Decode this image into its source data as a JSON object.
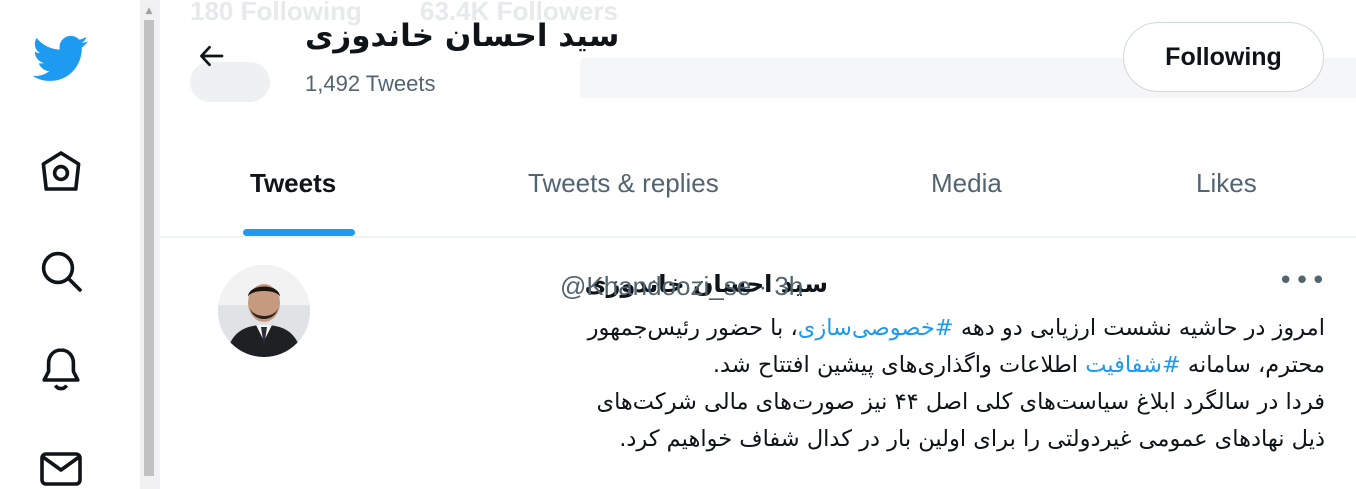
{
  "header": {
    "name": "سید احسان خاندوزی",
    "tweet_count": "1,492 Tweets",
    "follow_button": "Following",
    "ghost_following": "180 Following",
    "ghost_followers": "63.4K Followers"
  },
  "tabs": [
    {
      "label": "Tweets",
      "active": true
    },
    {
      "label": "Tweets & replies",
      "active": false
    },
    {
      "label": "Media",
      "active": false
    },
    {
      "label": "Likes",
      "active": false
    }
  ],
  "tweet": {
    "author_name": "سید احسان خاندوزی",
    "handle": "@Khandoozi_se",
    "separator": "·",
    "time": "3h",
    "more": "•••",
    "line1_a": "امروز در حاشیه نشست ارزیابی دو دهه ",
    "hashtag1": "#خصوصی‌سازی",
    "line1_b": "، با حضور رئیس‌جمهور",
    "line2_a": "محترم، سامانه ",
    "hashtag2": "#شفافیت",
    "line2_b": " اطلاعات واگذاری‌های پیشین افتتاح شد.",
    "line3": "فردا در سالگرد ابلاغ سیاست‌های کلی اصل ۴۴ نیز صورت‌های مالی شرکت‌های",
    "line4": "ذیل نهادهای عمومی غیردولتی را برای اولین بار در کدال شفاف خواهیم کرد."
  },
  "colors": {
    "brand": "#1d9bf0",
    "text": "#0f1419",
    "secondary": "#536471"
  },
  "icons": [
    "twitter-logo-icon",
    "home-icon",
    "search-icon",
    "notifications-bell-icon",
    "messages-envelope-icon",
    "back-arrow-icon",
    "more-options-icon"
  ]
}
